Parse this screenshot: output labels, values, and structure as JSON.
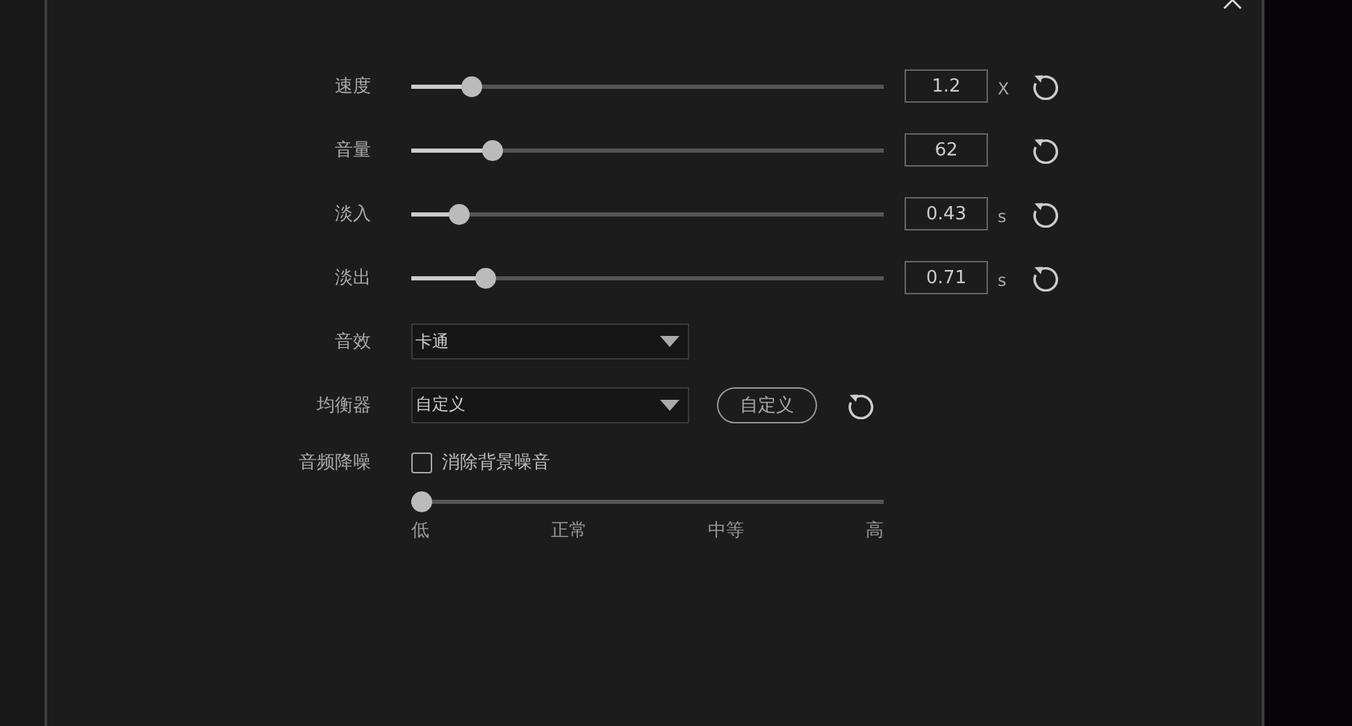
{
  "sliders": [
    {
      "label": "速度",
      "level": 0.11,
      "value": "1.2",
      "unit": "X"
    },
    {
      "label": "音量",
      "level": 0.156,
      "value": "62"
    },
    {
      "label": "淡入",
      "level": 0.082,
      "value": "0.43",
      "unit": "s"
    },
    {
      "label": "淡出",
      "level": 0.141,
      "value": "0.71",
      "unit": "s"
    }
  ],
  "dropdowns": [
    {
      "label": "音效",
      "value": "卡通"
    },
    {
      "label": "均衡器",
      "value": "自定义",
      "button": "自定义"
    }
  ],
  "noise_reduction": {
    "label": "音频降噪",
    "checkbox": {
      "label": "消除背景噪音",
      "checked": false
    },
    "level": 0,
    "ticks": [
      "低",
      "正常",
      "中等",
      "高"
    ]
  }
}
